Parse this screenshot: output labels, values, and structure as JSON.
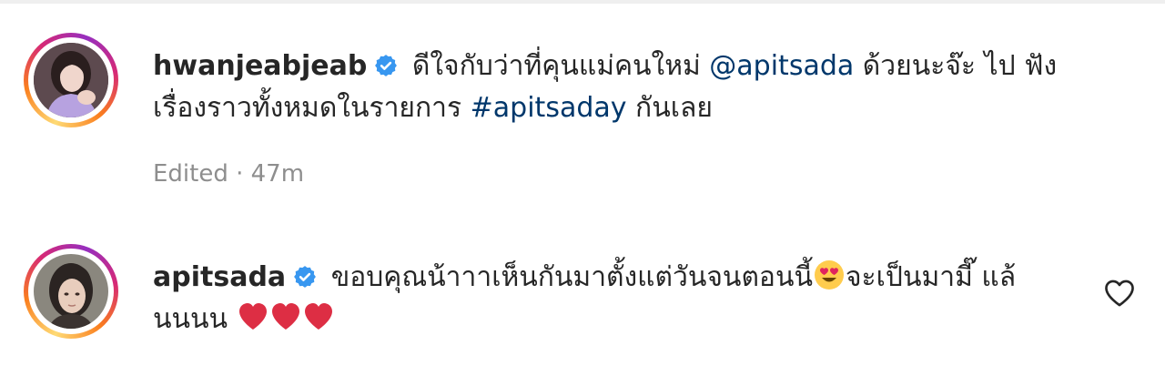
{
  "comments": [
    {
      "username": "hwanjeabjeab",
      "text_a": " ดีใจกับว่าที่คุนแม่คนใหม่ ",
      "mention": "@apitsada",
      "text_b": " ด้วยนะจ๊ะ ไป ฟังเรื่องราวทั้งหมดในรายการ ",
      "hashtag": "#apitsaday",
      "text_c": " กันเลย",
      "meta": "Edited · 47m"
    },
    {
      "username": "apitsada",
      "text_a": " ขอบคุณน้าาาเห็นกันมาตั้งแต่วันจนตอนนี้",
      "emoji_1": "smiling-face-with-heart-eyes",
      "text_b": "จะเป็นมามี๊ แล้นนนน ",
      "emoji_2": "red-heart",
      "emoji_count": 3
    }
  ],
  "colors": {
    "text": "#262626",
    "link": "#00376b",
    "meta": "#8e8e8e",
    "verified": "#3897f0",
    "heart": "#e0245e"
  }
}
